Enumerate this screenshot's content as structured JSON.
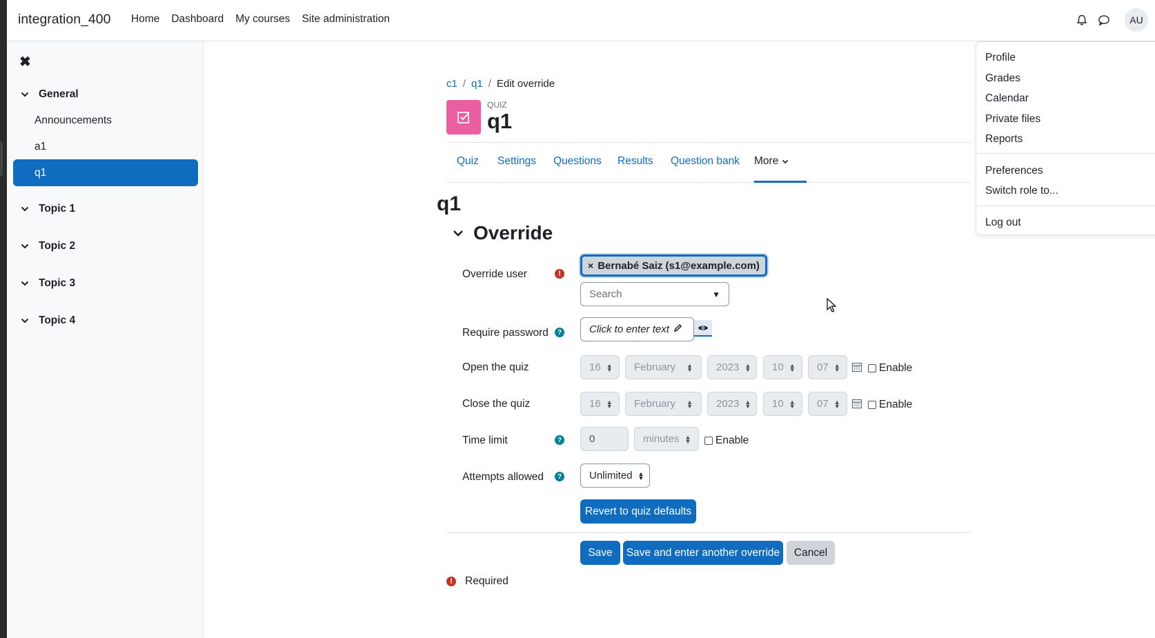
{
  "site": {
    "name": "integration_400"
  },
  "primary_nav": [
    "Home",
    "Dashboard",
    "My courses",
    "Site administration"
  ],
  "user": {
    "initials": "AU"
  },
  "user_menu": {
    "group1": [
      "Profile",
      "Grades",
      "Calendar",
      "Private files",
      "Reports"
    ],
    "group2": [
      "Preferences",
      "Switch role to..."
    ],
    "logout": "Log out"
  },
  "drawer": {
    "close_glyph": "✖",
    "general": "General",
    "items": [
      "Announcements",
      "a1",
      "q1"
    ],
    "topics": [
      "Topic 1",
      "Topic 2",
      "Topic 3",
      "Topic 4"
    ]
  },
  "breadcrumb": {
    "items": [
      "c1",
      "q1"
    ],
    "current": "Edit override",
    "sep": "/"
  },
  "module": {
    "type": "QUIZ",
    "title": "q1"
  },
  "tabs": [
    "Quiz",
    "Settings",
    "Questions",
    "Results",
    "Question bank",
    "More"
  ],
  "page_heading": "q1",
  "section_title": "Override",
  "form": {
    "override_user_label": "Override user",
    "selected_user": "Bernabé Saiz (s1@example.com)",
    "remove_glyph": "×",
    "search_placeholder": "Search",
    "require_password_label": "Require password",
    "password_placeholder": "Click to enter text",
    "open_label": "Open the quiz",
    "close_label": "Close the quiz",
    "date": {
      "day": "16",
      "month": "February",
      "year": "2023",
      "hour": "10",
      "minute": "07"
    },
    "enable_label": "Enable",
    "time_limit_label": "Time limit",
    "time_limit_value": "0",
    "time_limit_unit": "minutes",
    "attempts_label": "Attempts allowed",
    "attempts_value": "Unlimited",
    "revert_button": "Revert to quiz defaults",
    "save_button": "Save",
    "save_another_button": "Save and enter another override",
    "cancel_button": "Cancel",
    "required_note": "Required",
    "required_glyph": "!",
    "help_glyph": "?"
  },
  "colors": {
    "primary": "#0f6cbf",
    "quiz_icon": "#ec5ea2",
    "required": "#ca3120",
    "help": "#008196"
  }
}
